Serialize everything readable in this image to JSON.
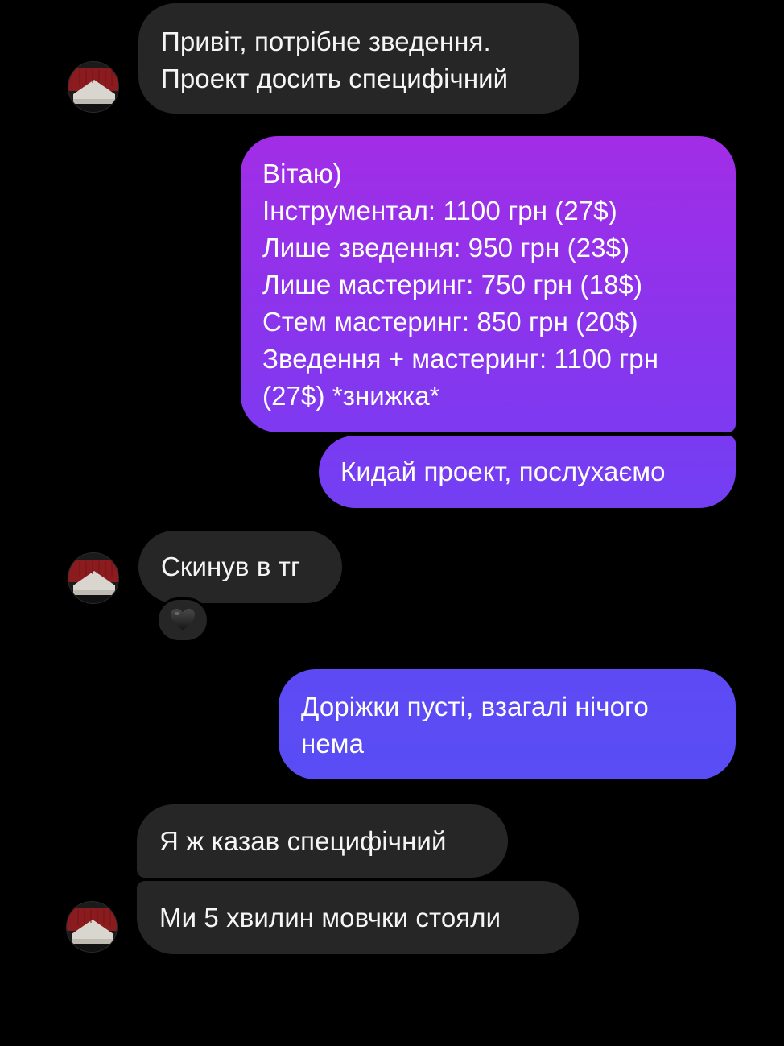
{
  "messages": [
    {
      "id": "m1",
      "direction": "incoming",
      "text": "Привіт, потрібне зведення.\nПроект досить специфічний"
    },
    {
      "id": "m2",
      "direction": "outgoing",
      "text": "Вітаю)\nІнструментал: 1100 грн (27$)\nЛише зведення: 950 грн (23$)\nЛише мастеринг: 750 грн (18$)\nСтем мастеринг: 850 грн (20$)\nЗведення + мастеринг: 1100 грн\n(27$) *знижка*"
    },
    {
      "id": "m3",
      "direction": "outgoing",
      "text": "Кидай проект, послухаємо"
    },
    {
      "id": "m4",
      "direction": "incoming",
      "text": "Скинув в тг",
      "reaction": "black-heart"
    },
    {
      "id": "m5",
      "direction": "outgoing",
      "text": "Доріжки пусті, взагалі нічого\nнема"
    },
    {
      "id": "m6",
      "direction": "incoming",
      "text": "Я ж казав специфічний"
    },
    {
      "id": "m7",
      "direction": "incoming",
      "text": "Ми 5 хвилин мовчки стояли"
    }
  ],
  "colors": {
    "background": "#000000",
    "incoming_bubble": "#262626",
    "outgoing_gradient_top": "#a12ee8",
    "outgoing_gradient_mid": "#7c3cf0",
    "outgoing_gradient_bottom": "#5a4cf5",
    "avatar_red": "#8b1b1e",
    "avatar_gray": "#d9d6d0"
  },
  "icons": {
    "avatar": "red-gray-striped-avatar",
    "reaction": "black-heart-emoji"
  }
}
